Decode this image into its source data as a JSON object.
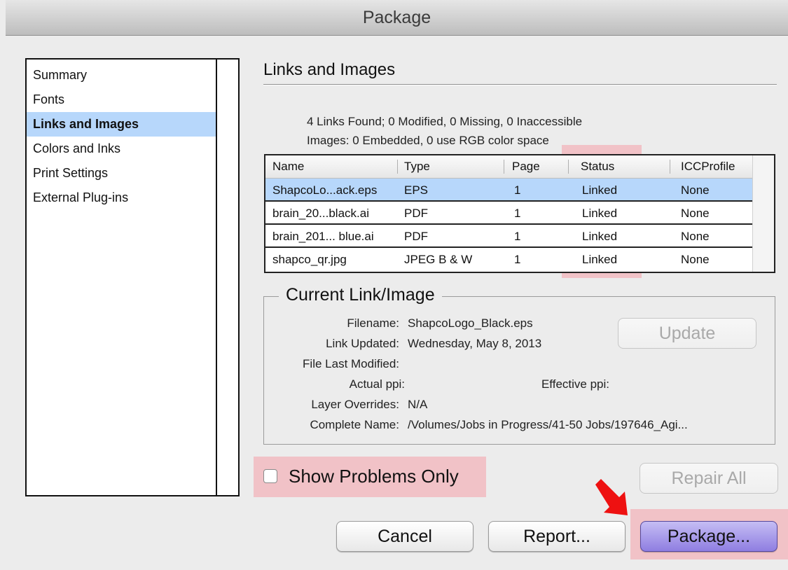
{
  "window": {
    "title": "Package"
  },
  "sidebar": {
    "items": [
      {
        "label": "Summary",
        "active": false
      },
      {
        "label": "Fonts",
        "active": false
      },
      {
        "label": "Links and Images",
        "active": true
      },
      {
        "label": "Colors and Inks",
        "active": false
      },
      {
        "label": "Print Settings",
        "active": false
      },
      {
        "label": "External Plug-ins",
        "active": false
      }
    ]
  },
  "main": {
    "title": "Links and Images",
    "summary_line1": "4 Links Found; 0 Modified, 0 Missing, 0 Inaccessible",
    "summary_line2": "Images: 0 Embedded, 0 use RGB color space",
    "table": {
      "columns": [
        "Name",
        "Type",
        "Page",
        "Status",
        "ICCProfile"
      ],
      "rows": [
        {
          "name": "ShapcoLo...ack.eps",
          "type": "EPS",
          "page": "1",
          "status": "Linked",
          "icc": "None",
          "selected": true
        },
        {
          "name": "brain_20...black.ai",
          "type": "PDF",
          "page": "1",
          "status": "Linked",
          "icc": "None",
          "selected": false
        },
        {
          "name": "brain_201... blue.ai",
          "type": "PDF",
          "page": "1",
          "status": "Linked",
          "icc": "None",
          "selected": false
        },
        {
          "name": "shapco_qr.jpg",
          "type": "JPEG B & W",
          "page": "1",
          "status": "Linked",
          "icc": "None",
          "selected": false
        }
      ]
    },
    "current": {
      "legend": "Current Link/Image",
      "filename_label": "Filename:",
      "filename": "ShapcoLogo_Black.eps",
      "link_updated_label": "Link Updated:",
      "link_updated": "Wednesday, May 8, 2013",
      "file_modified_label": "File Last Modified:",
      "actual_ppi_label": "Actual ppi:",
      "effective_ppi_label": "Effective ppi:",
      "layer_overrides_label": "Layer Overrides:",
      "layer_overrides": "N/A",
      "complete_name_label": "Complete Name:",
      "complete_name": "/Volumes/Jobs in Progress/41-50 Jobs/197646_Agi...",
      "update_label": "Update"
    },
    "show_problems_label": "Show Problems Only",
    "repair_all_label": "Repair All"
  },
  "footer": {
    "cancel_label": "Cancel",
    "report_label": "Report...",
    "package_label": "Package..."
  },
  "colors": {
    "selection": "#b7d7fb",
    "highlight": "#f5a0aa",
    "arrow": "#ee1111",
    "default_button": "#9d8fe6"
  },
  "icons": {
    "arrow": "arrow-pointer-icon"
  }
}
